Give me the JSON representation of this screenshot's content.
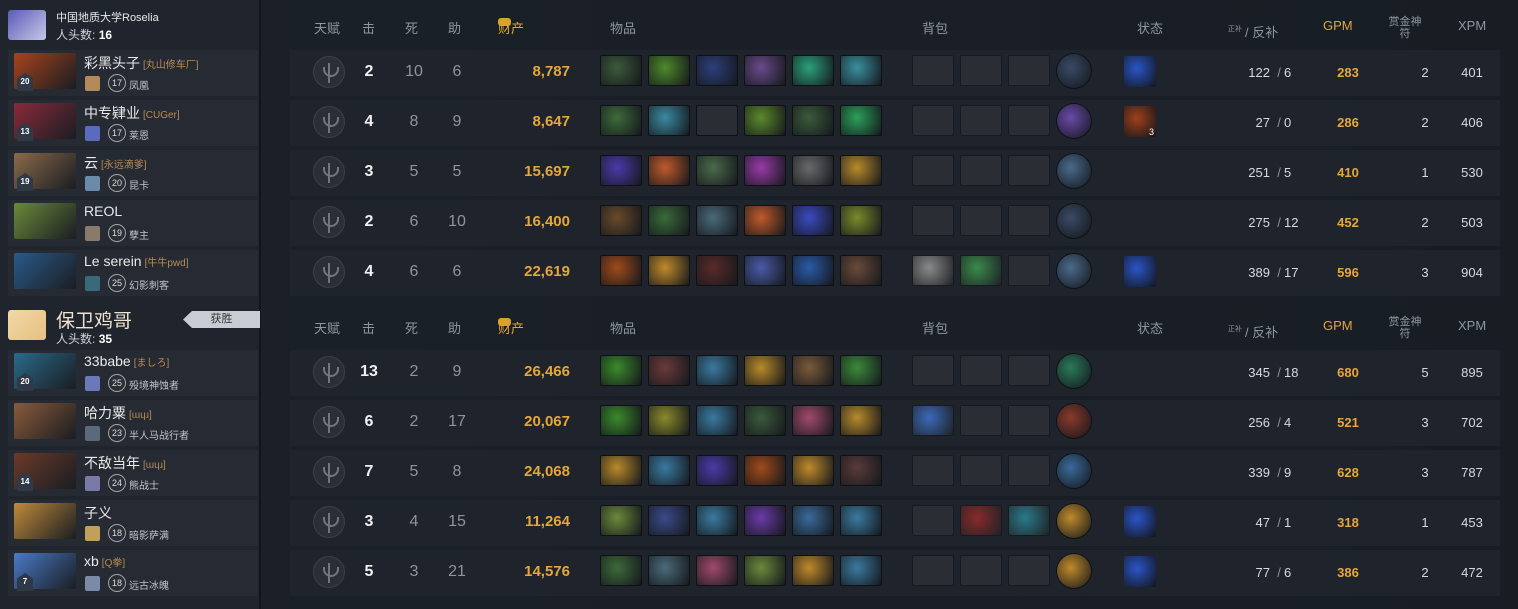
{
  "header": {
    "talent": "天赋",
    "kills": "击",
    "deaths": "死",
    "assists": "助",
    "networth": "财产",
    "items": "物品",
    "backpack": "背包",
    "status": "状态",
    "lh_small": "正补",
    "denies": "/ 反补",
    "gpm": "GPM",
    "bounty": "赏金神符",
    "xpm": "XPM"
  },
  "teams": [
    {
      "name": "中国地质大学Roselia",
      "kills_label": "人头数:",
      "kills": "16",
      "players": [
        {
          "name": "彩黑头子",
          "tag": "[丸山修车厂]",
          "level": "20",
          "player_level": "17",
          "hero": "凤凰",
          "k": "2",
          "d": "10",
          "a": "6",
          "nw": "8,787",
          "lh": "122",
          "dn": "6",
          "gpm": "283",
          "bounty": "2",
          "xpm": "401",
          "portrait": "#a8431c",
          "rank": "#b58a5a",
          "items": [
            "#3c5a3a",
            "#4d8a2a",
            "#2c3f7a",
            "#6a4a8a",
            "#2aa07a",
            "#3a8fa0"
          ],
          "bp": [
            "",
            "",
            ""
          ],
          "neutral": "#3a4a66",
          "status": "#2a55c8",
          "status_count": ""
        },
        {
          "name": "中专肄业",
          "tag": "[CUGer]",
          "level": "13",
          "player_level": "17",
          "hero": "莱恩",
          "k": "4",
          "d": "8",
          "a": "9",
          "nw": "8,647",
          "lh": "27",
          "dn": "0",
          "gpm": "286",
          "bounty": "2",
          "xpm": "406",
          "portrait": "#8a2a3a",
          "rank": "#5a6abf",
          "items": [
            "#3d6a3a",
            "#3a8aa0",
            "",
            "#5a8a2a",
            "#3a5a3a",
            "#2aa05a"
          ],
          "bp": [
            "",
            "",
            ""
          ],
          "neutral": "#6a4aa8",
          "status": "#a0401a",
          "status_count": "3"
        },
        {
          "name": "云",
          "tag": "[永远滴爹]",
          "level": "19",
          "player_level": "20",
          "hero": "昆卡",
          "k": "3",
          "d": "5",
          "a": "5",
          "nw": "15,697",
          "lh": "251",
          "dn": "5",
          "gpm": "410",
          "bounty": "1",
          "xpm": "530",
          "portrait": "#8a6a4a",
          "rank": "#6a8aa8",
          "items": [
            "#4a3aa8",
            "#c05a2a",
            "#4a6a4a",
            "#9a3aa8",
            "#6a6a6a",
            "#b88a2a"
          ],
          "bp": [
            "",
            "",
            ""
          ],
          "neutral": "#4a6a8a",
          "status": "",
          "status_count": ""
        },
        {
          "name": "REOL",
          "tag": "",
          "level": "",
          "player_level": "19",
          "hero": "孽主",
          "k": "2",
          "d": "6",
          "a": "10",
          "nw": "16,400",
          "lh": "275",
          "dn": "12",
          "gpm": "452",
          "bounty": "2",
          "xpm": "503",
          "portrait": "#6a8a3a",
          "rank": "#8a7a6a",
          "items": [
            "#6a4a2a",
            "#3a6a3a",
            "#4a6a7a",
            "#c05a2a",
            "#3a4ac0",
            "#7a8a2a"
          ],
          "bp": [
            "",
            "",
            ""
          ],
          "neutral": "#3a4a66",
          "status": "",
          "status_count": ""
        },
        {
          "name": "Le serein",
          "tag": "[牛牛pwd]",
          "level": "",
          "player_level": "25",
          "hero": "幻影刺客",
          "k": "4",
          "d": "6",
          "a": "6",
          "nw": "22,619",
          "lh": "389",
          "dn": "17",
          "gpm": "596",
          "bounty": "3",
          "xpm": "904",
          "portrait": "#2a5a8a",
          "rank": "#3a6a7a",
          "items": [
            "#a04a1a",
            "#c08a2a",
            "#5a2a2a",
            "#4a5aa8",
            "#2a5aa8",
            "#6a4a3a"
          ],
          "bp": [
            "#8a8a8a",
            "#3a8a4a",
            ""
          ],
          "neutral": "#4a6a8a",
          "status": "#2a55c8",
          "status_count": ""
        }
      ]
    },
    {
      "name": "保卫鸡哥",
      "kills_label": "人头数:",
      "kills": "35",
      "win": "获胜",
      "players": [
        {
          "name": "33babe",
          "tag": "[ましろ]",
          "level": "20",
          "player_level": "25",
          "hero": "殁境神蚀者",
          "k": "13",
          "d": "2",
          "a": "9",
          "nw": "26,466",
          "lh": "345",
          "dn": "18",
          "gpm": "680",
          "bounty": "5",
          "xpm": "895",
          "portrait": "#2a6a8a",
          "rank": "#6a7ab8",
          "items": [
            "#3a8a2a",
            "#6a3a3a",
            "#3a7aa0",
            "#b88a2a",
            "#7a5a3a",
            "#3a8a3a"
          ],
          "bp": [
            "",
            "",
            ""
          ],
          "neutral": "#2a7a5a",
          "status": "",
          "status_count": ""
        },
        {
          "name": "哈力粟",
          "tag": "[ɯɥɹ]",
          "level": "",
          "player_level": "23",
          "hero": "半人马战行者",
          "k": "6",
          "d": "2",
          "a": "17",
          "nw": "20,067",
          "lh": "256",
          "dn": "4",
          "gpm": "521",
          "bounty": "3",
          "xpm": "702",
          "portrait": "#8a5a3a",
          "rank": "#5a6a7a",
          "items": [
            "#3a8a2a",
            "#8a8a2a",
            "#3a7aa0",
            "#3a5a3a",
            "#a04a6a",
            "#b88a2a"
          ],
          "bp": [
            "#3a6ab8",
            "",
            ""
          ],
          "neutral": "#8a3a2a",
          "status": "",
          "status_count": ""
        },
        {
          "name": "不敌当年",
          "tag": "[ɯɥɹ]",
          "level": "14",
          "player_level": "24",
          "hero": "熊战士",
          "k": "7",
          "d": "5",
          "a": "8",
          "nw": "24,068",
          "lh": "339",
          "dn": "9",
          "gpm": "628",
          "bounty": "3",
          "xpm": "787",
          "portrait": "#6a3a2a",
          "rank": "#7a7aa8",
          "items": [
            "#b88a2a",
            "#3a7aa0",
            "#4a3aa8",
            "#a04a1a",
            "#c08a2a",
            "#5a3a3a"
          ],
          "bp": [
            "",
            "",
            ""
          ],
          "neutral": "#3a6a9a",
          "status": "",
          "status_count": ""
        },
        {
          "name": "子义",
          "tag": "",
          "level": "",
          "player_level": "18",
          "hero": "暗影萨满",
          "k": "3",
          "d": "4",
          "a": "15",
          "nw": "11,264",
          "lh": "47",
          "dn": "1",
          "gpm": "318",
          "bounty": "1",
          "xpm": "453",
          "portrait": "#c08a3a",
          "rank": "#c0a05a",
          "items": [
            "#6a8a3a",
            "#3a4a8a",
            "#3a7aa0",
            "#6a3aa8",
            "#3a6a9a",
            "#3a7aa0"
          ],
          "bp": [
            "",
            "#8a2a2a",
            "#2a7a8a"
          ],
          "neutral": "#c08a2a",
          "status": "#2a55c8",
          "status_count": ""
        },
        {
          "name": "xb",
          "tag": "[Q拳]",
          "level": "7",
          "player_level": "18",
          "hero": "远古冰魄",
          "k": "5",
          "d": "3",
          "a": "21",
          "nw": "14,576",
          "lh": "77",
          "dn": "6",
          "gpm": "386",
          "bounty": "2",
          "xpm": "472",
          "portrait": "#4a7ac8",
          "rank": "#7a8aa8",
          "items": [
            "#3d6a3a",
            "#4a6a7a",
            "#a04a6a",
            "#6a8a3a",
            "#c08a2a",
            "#3a7aa0"
          ],
          "bp": [
            "",
            "",
            ""
          ],
          "neutral": "#c08a2a",
          "status": "#2a55c8",
          "status_count": ""
        }
      ]
    }
  ]
}
